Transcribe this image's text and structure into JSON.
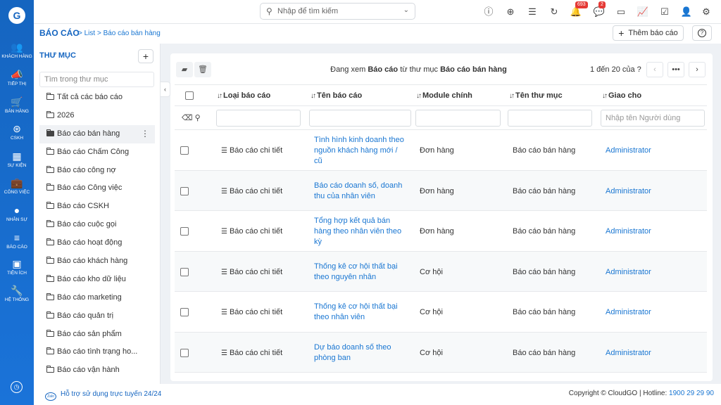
{
  "nav": {
    "logo": "G",
    "items": [
      {
        "label": "KHÁCH HÀNG",
        "icon": "customers-icon",
        "glyph": "👥"
      },
      {
        "label": "TIẾP THỊ",
        "icon": "megaphone-icon",
        "glyph": "📣"
      },
      {
        "label": "BÁN HÀNG",
        "icon": "cart-icon",
        "glyph": "🛒"
      },
      {
        "label": "CSKH",
        "icon": "lifebuoy-icon",
        "glyph": "⊛"
      },
      {
        "label": "SỰ KIỆN",
        "icon": "calendar-icon",
        "glyph": "▦"
      },
      {
        "label": "CÔNG VIỆC",
        "icon": "briefcase-icon",
        "glyph": "💼"
      },
      {
        "label": "NHÂN SỰ",
        "icon": "person-icon",
        "glyph": "●"
      },
      {
        "label": "BÁO CÁO",
        "icon": "report-icon",
        "glyph": "≡"
      },
      {
        "label": "TIỆN ÍCH",
        "icon": "utilities-icon",
        "glyph": "▣"
      },
      {
        "label": "HỆ THỐNG",
        "icon": "wrench-icon",
        "glyph": "🔧"
      }
    ]
  },
  "topbar": {
    "search_placeholder": "Nhập để tìm kiếm",
    "notifications_badge": "693",
    "messages_badge": "2"
  },
  "header": {
    "breadcrumb_root": "BÁO CÁO",
    "breadcrumb_rest": "> List > Báo cáo bán hàng",
    "add_button": "Thêm báo cáo"
  },
  "folders": {
    "title": "THƯ MỤC",
    "search_placeholder": "Tìm trong thư mục",
    "items": [
      "Tất cả các báo cáo",
      "2026",
      "Báo cáo bán hàng",
      "Báo cáo Chấm Công",
      "Báo cáo công nợ",
      "Báo cáo Công việc",
      "Báo cáo CSKH",
      "Báo cáo cuộc gọi",
      "Báo cáo hoạt động",
      "Báo cáo khách hàng",
      "Báo cáo kho dữ liệu",
      "Báo cáo marketing",
      "Báo cáo quản trị",
      "Báo cáo sản phẩm",
      "Báo cáo tình trạng ho...",
      "Báo cáo vận hành"
    ],
    "active_index": 2
  },
  "toolbar": {
    "viewing_prefix": "Đang xem",
    "viewing_entity": "Báo cáo",
    "viewing_mid": "từ thư mục",
    "viewing_folder": "Báo cáo bán hàng",
    "pagination": "1 đến 20 của ?"
  },
  "table": {
    "columns": [
      "Loại báo cáo",
      "Tên báo cáo",
      "Module chính",
      "Tên thư mục",
      "Giao cho"
    ],
    "assignee_filter_placeholder": "Nhập tên Người dùng",
    "rows": [
      {
        "type": "Báo cáo chi tiết",
        "name": "Tình hình kinh doanh theo nguồn khách hàng mới / cũ",
        "module": "Đơn hàng",
        "folder": "Báo cáo bán hàng",
        "assignee": "Administrator"
      },
      {
        "type": "Báo cáo chi tiết",
        "name": "Báo cáo doanh số, doanh thu của nhân viên",
        "module": "Đơn hàng",
        "folder": "Báo cáo bán hàng",
        "assignee": "Administrator"
      },
      {
        "type": "Báo cáo chi tiết",
        "name": "Tổng hợp kết quả bán hàng theo nhân viên theo kỳ",
        "module": "Đơn hàng",
        "folder": "Báo cáo bán hàng",
        "assignee": "Administrator"
      },
      {
        "type": "Báo cáo chi tiết",
        "name": "Thống kê cơ hội thất bại theo nguyên nhân",
        "module": "Cơ hội",
        "folder": "Báo cáo bán hàng",
        "assignee": "Administrator"
      },
      {
        "type": "Báo cáo chi tiết",
        "name": "Thống kê cơ hội thất bại theo nhân viên",
        "module": "Cơ hội",
        "folder": "Báo cáo bán hàng",
        "assignee": "Administrator"
      },
      {
        "type": "Báo cáo chi tiết",
        "name": "Dự báo doanh số theo phòng ban",
        "module": "Cơ hội",
        "folder": "Báo cáo bán hàng",
        "assignee": "Administrator"
      }
    ]
  },
  "footer": {
    "logo_text": "Zalo",
    "support": "Hỗ trợ sử dụng trực tuyến 24/24",
    "copyright": "Copyright © CloudGO | Hotline:",
    "hotline": "1900 29 29 90"
  },
  "colors": {
    "brand": "#1565c0",
    "link": "#1976d2",
    "badge": "#e53935"
  }
}
